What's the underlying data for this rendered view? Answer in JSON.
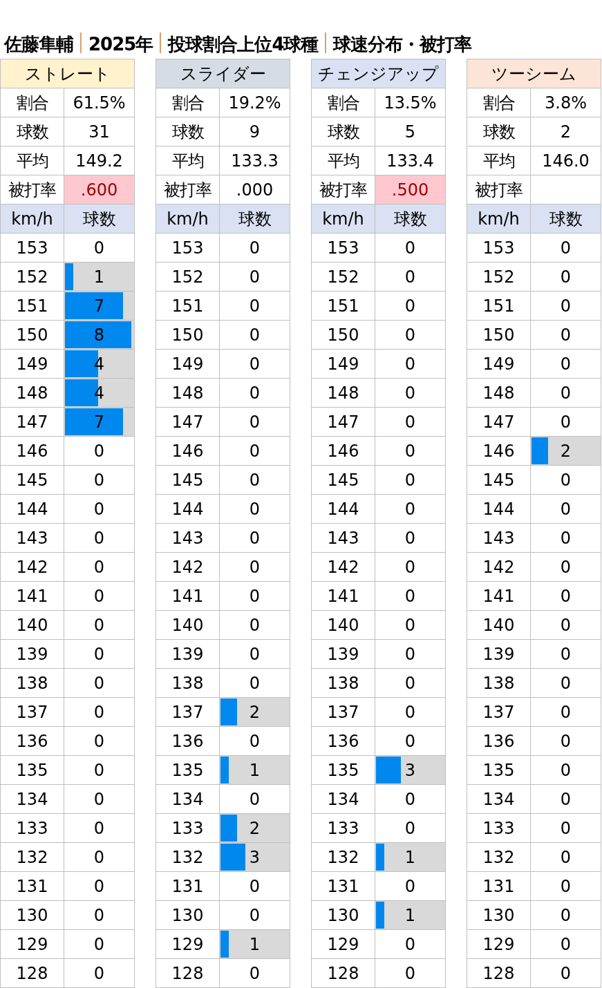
{
  "title": [
    "佐藤隼輔",
    "2025年",
    "投球割合上位4球種",
    "球速分布・被打率"
  ],
  "pitches": [
    {
      "name": "ストレート",
      "color": "#fff2cc",
      "stats": [
        {
          "label": "割合",
          "value": "61.5%"
        },
        {
          "label": "球数",
          "value": "31"
        },
        {
          "label": "平均",
          "value": "149.2"
        },
        {
          "label": "被打率",
          "value": ".600",
          "highlight": true
        }
      ],
      "columns": [
        "km/h",
        "球数"
      ],
      "rows": [
        {
          "speed": "153",
          "count": "0"
        },
        {
          "speed": "152",
          "count": "1",
          "level": 0.125
        },
        {
          "speed": "151",
          "count": "7",
          "level": 0.875
        },
        {
          "speed": "150",
          "count": "8",
          "level": 1
        },
        {
          "speed": "149",
          "count": "4",
          "level": 0.5
        },
        {
          "speed": "148",
          "count": "4",
          "level": 0.5
        },
        {
          "speed": "147",
          "count": "7",
          "level": 0.875
        },
        {
          "speed": "146",
          "count": "0"
        },
        {
          "speed": "145",
          "count": "0"
        },
        {
          "speed": "144",
          "count": "0"
        },
        {
          "speed": "143",
          "count": "0"
        },
        {
          "speed": "142",
          "count": "0"
        },
        {
          "speed": "141",
          "count": "0"
        },
        {
          "speed": "140",
          "count": "0"
        },
        {
          "speed": "139",
          "count": "0"
        },
        {
          "speed": "138",
          "count": "0"
        },
        {
          "speed": "137",
          "count": "0"
        },
        {
          "speed": "136",
          "count": "0"
        },
        {
          "speed": "135",
          "count": "0"
        },
        {
          "speed": "134",
          "count": "0"
        },
        {
          "speed": "133",
          "count": "0"
        },
        {
          "speed": "132",
          "count": "0"
        },
        {
          "speed": "131",
          "count": "0"
        },
        {
          "speed": "130",
          "count": "0"
        },
        {
          "speed": "129",
          "count": "0"
        },
        {
          "speed": "128",
          "count": "0"
        }
      ]
    },
    {
      "name": "スライダー",
      "color": "#d6dce4",
      "stats": [
        {
          "label": "割合",
          "value": "19.2%"
        },
        {
          "label": "球数",
          "value": "9"
        },
        {
          "label": "平均",
          "value": "133.3"
        },
        {
          "label": "被打率",
          "value": ".000",
          "highlight": false
        }
      ],
      "columns": [
        "km/h",
        "球数"
      ],
      "rows": [
        {
          "speed": "153",
          "count": "0"
        },
        {
          "speed": "152",
          "count": "0"
        },
        {
          "speed": "151",
          "count": "0"
        },
        {
          "speed": "150",
          "count": "0"
        },
        {
          "speed": "149",
          "count": "0"
        },
        {
          "speed": "148",
          "count": "0"
        },
        {
          "speed": "147",
          "count": "0"
        },
        {
          "speed": "146",
          "count": "0"
        },
        {
          "speed": "145",
          "count": "0"
        },
        {
          "speed": "144",
          "count": "0"
        },
        {
          "speed": "143",
          "count": "0"
        },
        {
          "speed": "142",
          "count": "0"
        },
        {
          "speed": "141",
          "count": "0"
        },
        {
          "speed": "140",
          "count": "0"
        },
        {
          "speed": "139",
          "count": "0"
        },
        {
          "speed": "138",
          "count": "0"
        },
        {
          "speed": "137",
          "count": "2",
          "level": 0.25
        },
        {
          "speed": "136",
          "count": "0"
        },
        {
          "speed": "135",
          "count": "1",
          "level": 0.125
        },
        {
          "speed": "134",
          "count": "0"
        },
        {
          "speed": "133",
          "count": "2",
          "level": 0.25
        },
        {
          "speed": "132",
          "count": "3",
          "level": 0.375
        },
        {
          "speed": "131",
          "count": "0"
        },
        {
          "speed": "130",
          "count": "0"
        },
        {
          "speed": "129",
          "count": "1",
          "level": 0.125
        },
        {
          "speed": "128",
          "count": "0"
        }
      ]
    },
    {
      "name": "チェンジアップ",
      "color": "#d9e1f2",
      "stats": [
        {
          "label": "割合",
          "value": "13.5%"
        },
        {
          "label": "球数",
          "value": "5"
        },
        {
          "label": "平均",
          "value": "133.4"
        },
        {
          "label": "被打率",
          "value": ".500",
          "highlight": true
        }
      ],
      "columns": [
        "km/h",
        "球数"
      ],
      "rows": [
        {
          "speed": "153",
          "count": "0"
        },
        {
          "speed": "152",
          "count": "0"
        },
        {
          "speed": "151",
          "count": "0"
        },
        {
          "speed": "150",
          "count": "0"
        },
        {
          "speed": "149",
          "count": "0"
        },
        {
          "speed": "148",
          "count": "0"
        },
        {
          "speed": "147",
          "count": "0"
        },
        {
          "speed": "146",
          "count": "0"
        },
        {
          "speed": "145",
          "count": "0"
        },
        {
          "speed": "144",
          "count": "0"
        },
        {
          "speed": "143",
          "count": "0"
        },
        {
          "speed": "142",
          "count": "0"
        },
        {
          "speed": "141",
          "count": "0"
        },
        {
          "speed": "140",
          "count": "0"
        },
        {
          "speed": "139",
          "count": "0"
        },
        {
          "speed": "138",
          "count": "0"
        },
        {
          "speed": "137",
          "count": "0"
        },
        {
          "speed": "136",
          "count": "0"
        },
        {
          "speed": "135",
          "count": "3",
          "level": 0.375
        },
        {
          "speed": "134",
          "count": "0"
        },
        {
          "speed": "133",
          "count": "0"
        },
        {
          "speed": "132",
          "count": "1",
          "level": 0.125
        },
        {
          "speed": "131",
          "count": "0"
        },
        {
          "speed": "130",
          "count": "1",
          "level": 0.125
        },
        {
          "speed": "129",
          "count": "0"
        },
        {
          "speed": "128",
          "count": "0"
        }
      ]
    },
    {
      "name": "ツーシーム",
      "color": "#fce4d6",
      "stats": [
        {
          "label": "割合",
          "value": "3.8%"
        },
        {
          "label": "球数",
          "value": "2"
        },
        {
          "label": "平均",
          "value": "146.0"
        },
        {
          "label": "被打率"
        }
      ],
      "columns": [
        "km/h",
        "球数"
      ],
      "rows": [
        {
          "speed": "153",
          "count": "0"
        },
        {
          "speed": "152",
          "count": "0"
        },
        {
          "speed": "151",
          "count": "0"
        },
        {
          "speed": "150",
          "count": "0"
        },
        {
          "speed": "149",
          "count": "0"
        },
        {
          "speed": "148",
          "count": "0"
        },
        {
          "speed": "147",
          "count": "0"
        },
        {
          "speed": "146",
          "count": "2",
          "level": 0.25
        },
        {
          "speed": "145",
          "count": "0"
        },
        {
          "speed": "144",
          "count": "0"
        },
        {
          "speed": "143",
          "count": "0"
        },
        {
          "speed": "142",
          "count": "0"
        },
        {
          "speed": "141",
          "count": "0"
        },
        {
          "speed": "140",
          "count": "0"
        },
        {
          "speed": "139",
          "count": "0"
        },
        {
          "speed": "138",
          "count": "0"
        },
        {
          "speed": "137",
          "count": "0"
        },
        {
          "speed": "136",
          "count": "0"
        },
        {
          "speed": "135",
          "count": "0"
        },
        {
          "speed": "134",
          "count": "0"
        },
        {
          "speed": "133",
          "count": "0"
        },
        {
          "speed": "132",
          "count": "0"
        },
        {
          "speed": "131",
          "count": "0"
        },
        {
          "speed": "130",
          "count": "0"
        },
        {
          "speed": "129",
          "count": "0"
        },
        {
          "speed": "128",
          "count": "0"
        }
      ]
    }
  ]
}
